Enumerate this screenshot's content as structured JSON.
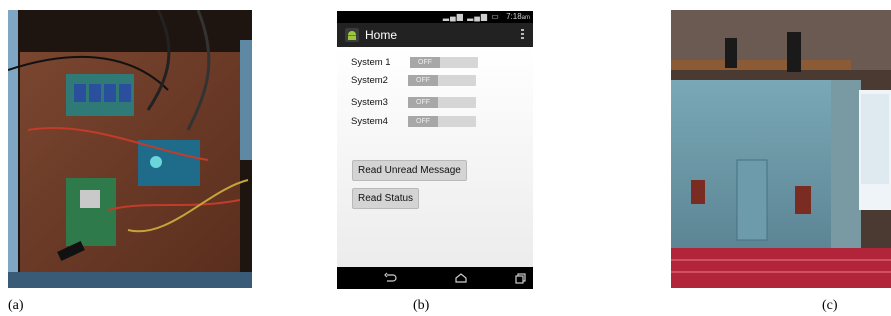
{
  "captions": {
    "a": "(a)",
    "b": "(b)",
    "c": "(c)"
  },
  "photos": {
    "a": {
      "icon": "circuit-board-photo"
    },
    "c": {
      "icon": "house-model-photo"
    }
  },
  "phone": {
    "status_bar": {
      "time": "7:18",
      "ampm": "am"
    },
    "action_bar": {
      "title": "Home",
      "app_icon": "android-icon",
      "menu_icon": "overflow-menu-icon"
    },
    "systems": [
      {
        "label": "System 1",
        "state": "OFF"
      },
      {
        "label": "System2",
        "state": "OFF"
      },
      {
        "label": "System3",
        "state": "OFF"
      },
      {
        "label": "System4",
        "state": "OFF"
      }
    ],
    "buttons": {
      "read_unread": "Read Unread Message",
      "read_status": "Read Status"
    },
    "nav": {
      "back_icon": "back-icon",
      "home_icon": "home-icon",
      "recents_icon": "recents-icon"
    }
  },
  "colors": {
    "action_bar": "#222222",
    "toggle_off": "#a7a7a7",
    "android_green": "#9bc53d"
  }
}
